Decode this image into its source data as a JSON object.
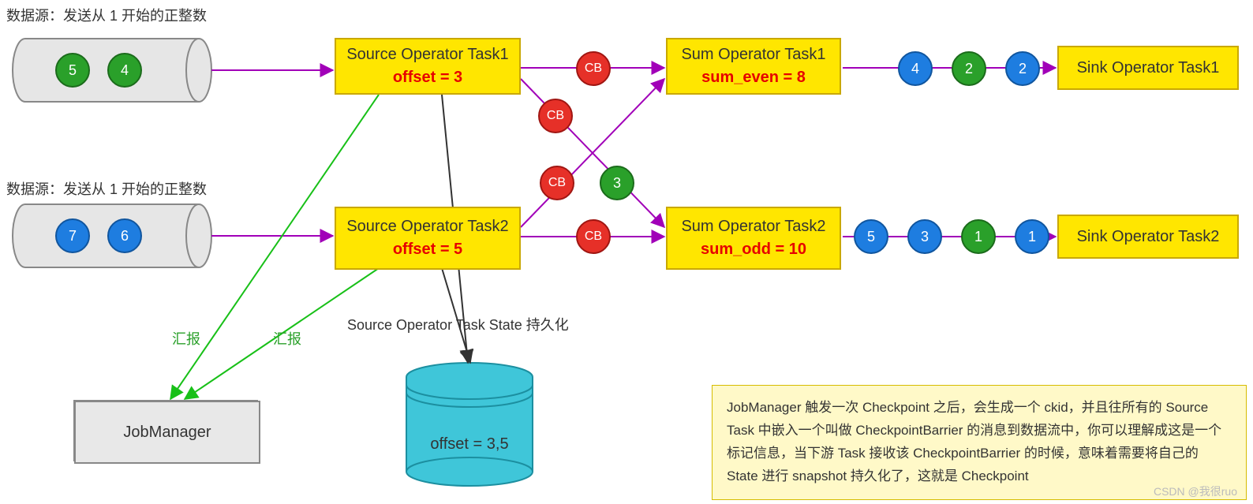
{
  "labels": {
    "ds1": "数据源：发送从 1 开始的正整数",
    "ds2": "数据源：发送从 1 开始的正整数",
    "report": "汇报",
    "state_persist": "Source Operator Task State 持久化"
  },
  "datasources": [
    {
      "items": [
        "5",
        "4"
      ]
    },
    {
      "items": [
        "7",
        "6"
      ]
    }
  ],
  "operators": {
    "source": [
      {
        "title": "Source Operator Task1",
        "state": "offset = 3"
      },
      {
        "title": "Source Operator Task2",
        "state": "offset = 5"
      }
    ],
    "sum": [
      {
        "title": "Sum Operator Task1",
        "state": "sum_even = 8"
      },
      {
        "title": "Sum Operator Task2",
        "state": "sum_odd = 10"
      }
    ],
    "sink": [
      {
        "title": "Sink Operator Task1"
      },
      {
        "title": "Sink Operator Task2"
      }
    ]
  },
  "barriers": {
    "cb": "CB",
    "inflight_green": "3"
  },
  "streams": [
    {
      "items": [
        "4",
        "2",
        "2"
      ]
    },
    {
      "items": [
        "5",
        "3",
        "1",
        "1"
      ]
    }
  ],
  "jobmanager": {
    "label": "JobManager"
  },
  "state_store": {
    "text": "offset = 3,5"
  },
  "note": {
    "text": "JobManager 触发一次 Checkpoint 之后，会生成一个 ckid，并且往所有的 Source Task 中嵌入一个叫做 CheckpointBarrier 的消息到数据流中，你可以理解成这是一个标记信息，当下游 Task 接收该 CheckpointBarrier 的时候，意味着需要将自己的 State 进行 snapshot 持久化了，这就是 Checkpoint"
  },
  "watermark": "CSDN @我很ruo",
  "colors": {
    "green": "#2aa02a",
    "blue": "#1e7de0",
    "red": "#e63028",
    "yellow": "#ffe600",
    "purple": "#a100b8",
    "cyan": "#3fc6d9",
    "grey": "#e6e6e6"
  }
}
